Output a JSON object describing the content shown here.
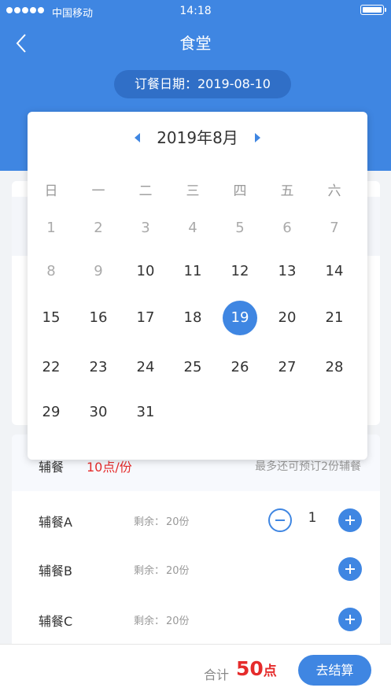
{
  "status_bar": {
    "carrier": "中国移动",
    "time": "14:18"
  },
  "header": {
    "title": "食堂",
    "order_date": "订餐日期：2019-08-10"
  },
  "calendar": {
    "title": "2019年8月",
    "weekdays": [
      "日",
      "一",
      "二",
      "三",
      "四",
      "五",
      "六"
    ],
    "rows": [
      [
        "1",
        "2",
        "3",
        "4",
        "5",
        "6",
        "7"
      ],
      [
        "8",
        "9",
        "10",
        "11",
        "12",
        "13",
        "14"
      ],
      [
        "15",
        "16",
        "17",
        "18",
        "19",
        "20",
        "21"
      ],
      [
        "22",
        "23",
        "24",
        "25",
        "26",
        "27",
        "28"
      ],
      [
        "29",
        "30",
        "31"
      ]
    ],
    "selected_day": "19"
  },
  "side_dishes": {
    "title": "辅餐",
    "price": "10点/份",
    "note": "最多还可预订2份辅餐",
    "items": [
      {
        "name": "辅餐A",
        "stock_label": "剩余：",
        "stock_value": "20份",
        "qty": "1"
      },
      {
        "name": "辅餐B",
        "stock_label": "剩余：",
        "stock_value": "20份"
      },
      {
        "name": "辅餐C",
        "stock_label": "剩余：",
        "stock_value": "20份"
      }
    ]
  },
  "footer": {
    "total_label": "合计",
    "total_value": "50",
    "total_unit": "点",
    "checkout_label": "去结算"
  },
  "colors": {
    "primary": "#3f86e2",
    "price_red": "#e52b2b"
  }
}
